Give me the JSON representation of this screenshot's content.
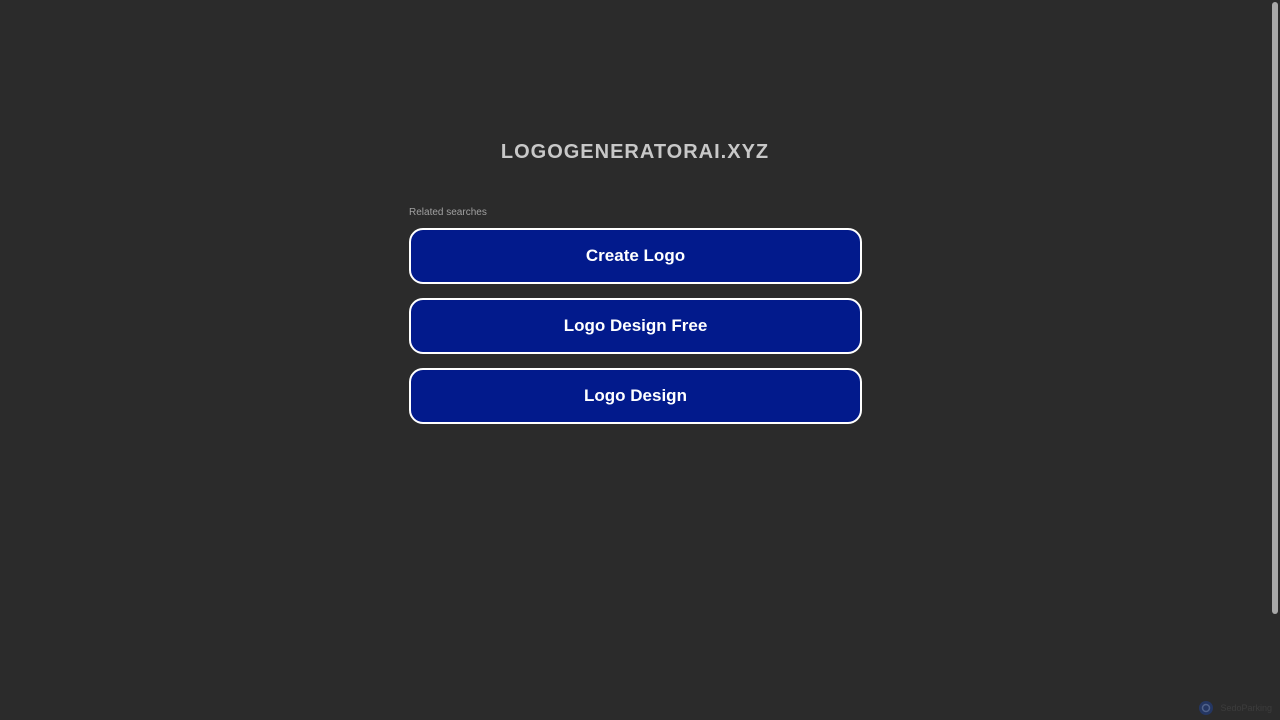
{
  "header": {
    "domain": "LOGOGENERATORAI.XYZ"
  },
  "related": {
    "label": "Related searches",
    "items": [
      {
        "label": "Create Logo"
      },
      {
        "label": "Logo Design Free"
      },
      {
        "label": "Logo Design"
      }
    ]
  },
  "footer": {
    "text": "SedoParking",
    "icon": "badge-logo-icon"
  },
  "colors": {
    "background": "#2b2b2b",
    "button": "#021a8c",
    "button_border": "#ffffff"
  }
}
